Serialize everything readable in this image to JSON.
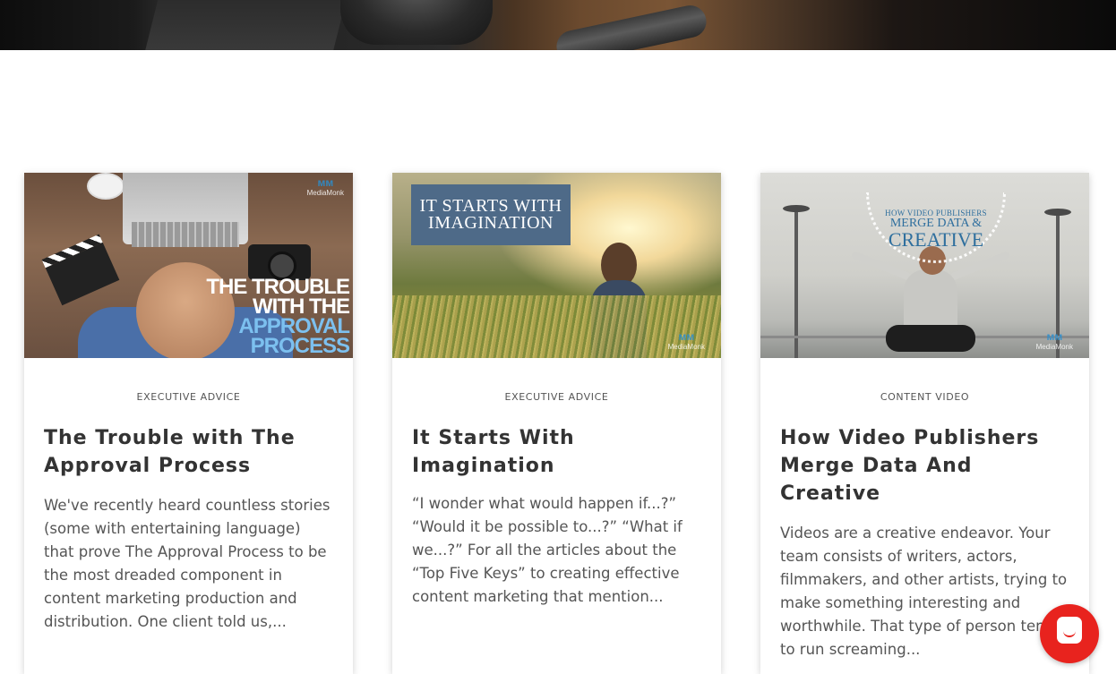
{
  "hero": {
    "image": "dark desk photo with laptop, coffee mug and pen"
  },
  "cards": [
    {
      "thumbnail": {
        "overlay_lines": [
          "THE TROUBLE",
          "WITH THE",
          "APPROVAL",
          "PROCESS"
        ],
        "logo_text": "MediaMonk",
        "logo_icon": "mm-logo-icon"
      },
      "category": "EXECUTIVE ADVICE",
      "title": "The Trouble with The Approval Process",
      "excerpt": "We've recently heard countless stories (some with entertaining language) that prove The Approval Process to be the most dreaded component in content marketing production and distribution. One client told us,..."
    },
    {
      "thumbnail": {
        "overlay_lines": [
          "IT STARTS WITH",
          "IMAGINATION"
        ],
        "logo_text": "MediaMonk",
        "logo_icon": "mm-logo-icon"
      },
      "category": "EXECUTIVE ADVICE",
      "title": "It Starts With Imagination",
      "excerpt": "“I wonder what would happen if...?” “Would it be possible to...?” “What if we...?” For all the articles about the “Top Five Keys” to creating effective content marketing that mention..."
    },
    {
      "thumbnail": {
        "overlay_lines": [
          "HOW VIDEO PUBLISHERS",
          "MERGE DATA &",
          "CREATIVE"
        ],
        "logo_text": "MediaMonk",
        "logo_icon": "mm-logo-icon"
      },
      "category": "CONTENT VIDEO",
      "title": "How Video Publishers Merge Data And Creative",
      "excerpt": "Videos are a creative endeavor. Your team consists of writers, actors, filmmakers, and other artists, trying to make something interesting and worthwhile. That type of person tends to run screaming..."
    }
  ],
  "chat_widget": {
    "icon": "chat-bubble-icon",
    "color": "#e8231e"
  },
  "colors": {
    "title": "#333333",
    "text": "#555555",
    "accent_blue": "#7cc0ef",
    "imagination_box": "#4e6a88",
    "creative_text": "#2f6f9e"
  }
}
